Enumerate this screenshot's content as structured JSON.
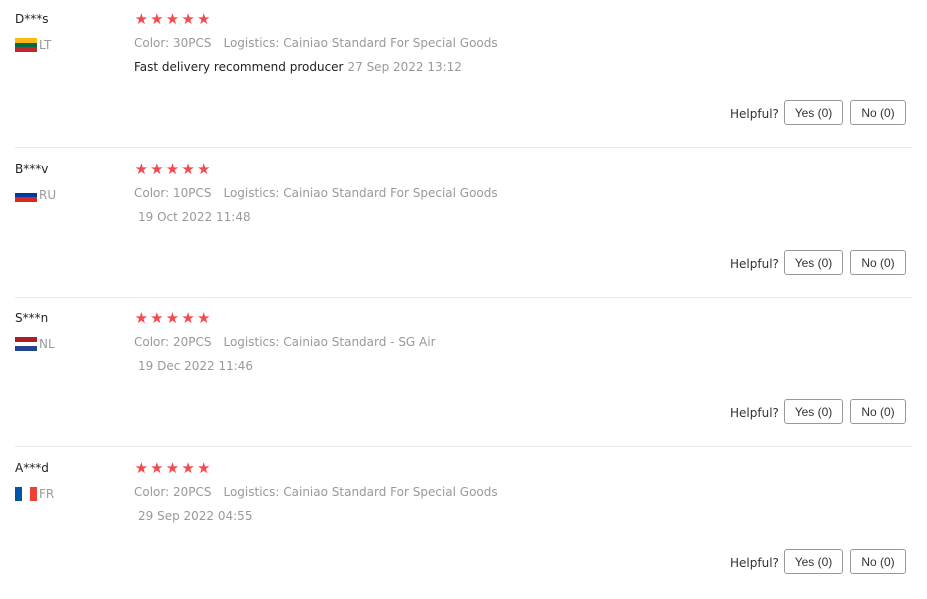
{
  "reviews": [
    {
      "user": "D***s",
      "country": "LT",
      "flag_colors": [
        "#FDB913",
        "#006A44",
        "#C1272D"
      ],
      "flag_orientation": "horizontal",
      "rating": 5,
      "color_label": "Color: 30PCS",
      "logistics_label": "Logistics: Cainiao Standard For Special Goods",
      "text": "Fast delivery recommend producer",
      "date": "27 Sep 2022 13:12",
      "helpful_label": "Helpful?",
      "yes_label": "Yes (0)",
      "no_label": "No (0)"
    },
    {
      "user": "B***v",
      "country": "RU",
      "flag_colors": [
        "#FFFFFF",
        "#0039A6",
        "#D52B1E"
      ],
      "flag_orientation": "horizontal",
      "rating": 5,
      "color_label": "Color: 10PCS",
      "logistics_label": "Logistics: Cainiao Standard For Special Goods",
      "text": "",
      "date": "19 Oct 2022 11:48",
      "helpful_label": "Helpful?",
      "yes_label": "Yes (0)",
      "no_label": "No (0)"
    },
    {
      "user": "S***n",
      "country": "NL",
      "flag_colors": [
        "#AE1C28",
        "#FFFFFF",
        "#21468B"
      ],
      "flag_orientation": "horizontal",
      "rating": 5,
      "color_label": "Color: 20PCS",
      "logistics_label": "Logistics: Cainiao Standard - SG Air",
      "text": "",
      "date": "19 Dec 2022 11:46",
      "helpful_label": "Helpful?",
      "yes_label": "Yes (0)",
      "no_label": "No (0)"
    },
    {
      "user": "A***d",
      "country": "FR",
      "flag_colors": [
        "#0055A4",
        "#FFFFFF",
        "#EF4135"
      ],
      "flag_orientation": "vertical",
      "rating": 5,
      "color_label": "Color: 20PCS",
      "logistics_label": "Logistics: Cainiao Standard For Special Goods",
      "text": "",
      "date": "29 Sep 2022 04:55",
      "helpful_label": "Helpful?",
      "yes_label": "Yes (0)",
      "no_label": "No (0)"
    }
  ],
  "colors": {
    "star": "#f5494e",
    "muted_text": "#999999",
    "divider": "#e8e8e8"
  }
}
